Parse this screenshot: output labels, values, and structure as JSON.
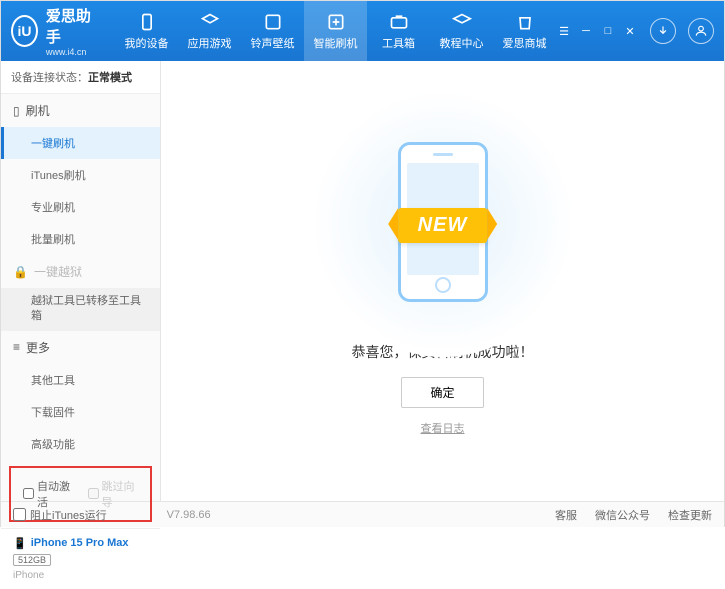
{
  "header": {
    "logo_letters": "iU",
    "app_name": "爱思助手",
    "url": "www.i4.cn",
    "nav": [
      {
        "label": "我的设备"
      },
      {
        "label": "应用游戏"
      },
      {
        "label": "铃声壁纸"
      },
      {
        "label": "智能刷机"
      },
      {
        "label": "工具箱"
      },
      {
        "label": "教程中心"
      },
      {
        "label": "爱思商城"
      }
    ]
  },
  "sidebar": {
    "status_label": "设备连接状态：",
    "status_value": "正常模式",
    "sections": {
      "flash": "刷机",
      "jailbreak": "一键越狱",
      "more": "更多"
    },
    "flash_items": [
      "一键刷机",
      "iTunes刷机",
      "专业刷机",
      "批量刷机"
    ],
    "jailbreak_note": "越狱工具已转移至工具箱",
    "more_items": [
      "其他工具",
      "下载固件",
      "高级功能"
    ],
    "checkboxes": {
      "auto_activate": "自动激活",
      "skip_guide": "跳过向导"
    },
    "device": {
      "name": "iPhone 15 Pro Max",
      "storage": "512GB",
      "type": "iPhone"
    }
  },
  "main": {
    "badge": "NEW",
    "success_text": "恭喜您，保资料刷机成功啦！",
    "ok_button": "确定",
    "view_log": "查看日志"
  },
  "footer": {
    "block_itunes": "阻止iTunes运行",
    "version": "V7.98.66",
    "links": [
      "客服",
      "微信公众号",
      "检查更新"
    ]
  }
}
